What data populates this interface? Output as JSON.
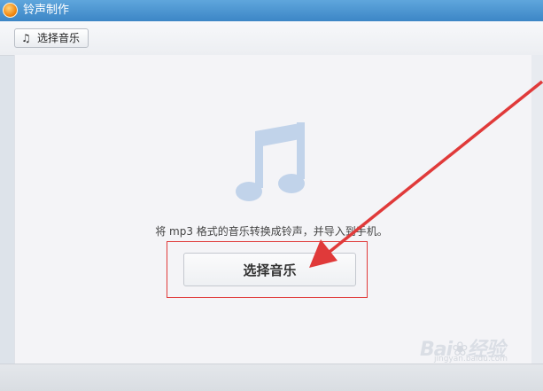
{
  "window": {
    "title": "铃声制作"
  },
  "toolbar": {
    "select_music_label": "选择音乐",
    "select_music_icon": "music-note-icon"
  },
  "main": {
    "icon": "music-note-icon",
    "description": "将 mp3 格式的音乐转换成铃声，并导入到手机。",
    "select_music_button": "选择音乐"
  },
  "watermark": {
    "brand": "Bai",
    "brand_suffix": "经验",
    "site": "jingyan.baidu.com"
  },
  "colors": {
    "titlebar": "#3c86c6",
    "accent_red": "#e03a3a",
    "icon_blue": "#c1d3ea"
  }
}
